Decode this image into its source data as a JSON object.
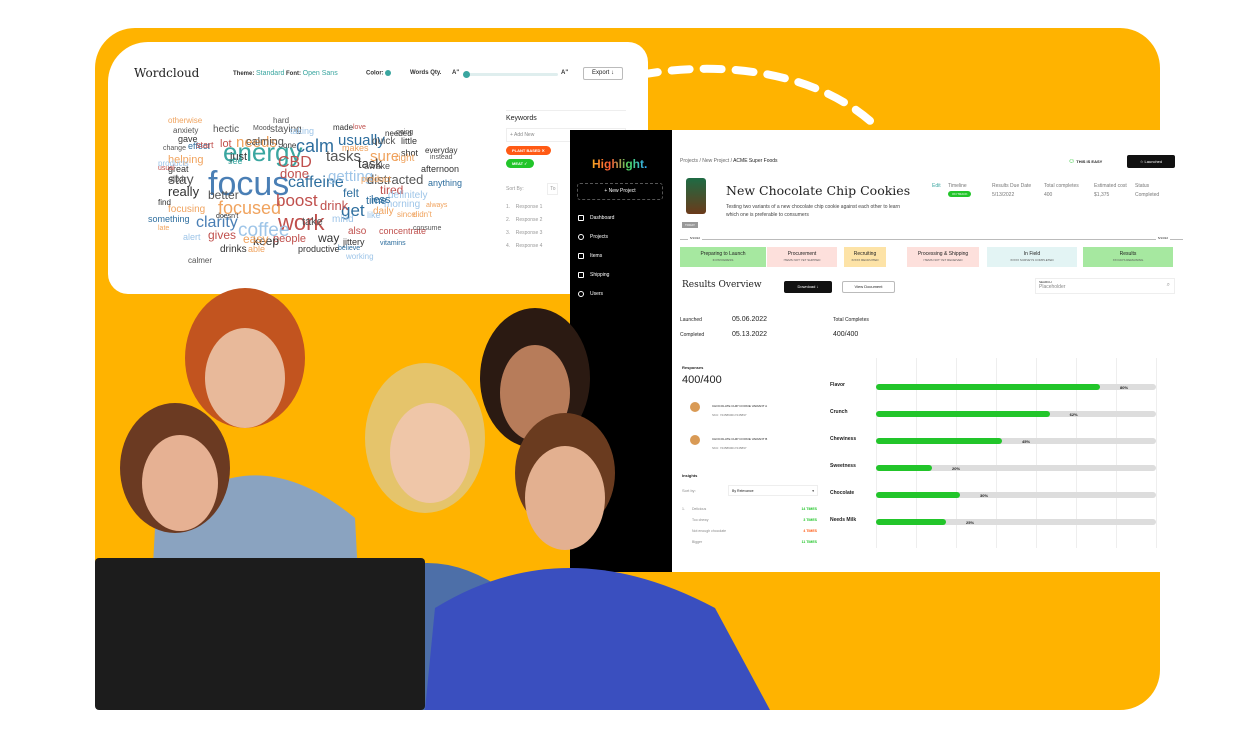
{
  "wordcloud": {
    "title": "Wordcloud",
    "theme_label": "Theme:",
    "theme": "Standard",
    "font_label": "Font:",
    "font": "Open Sans",
    "color_label": "Color:",
    "words_label": "Words Qty.",
    "a_small": "A\"",
    "a_large": "A\"",
    "export": "Export ↓",
    "words": [
      {
        "t": "focus",
        "c": "#4a7fb5"
      },
      {
        "t": "energy",
        "c": "#3aa6a0"
      },
      {
        "t": "work",
        "c": "#c0504d"
      },
      {
        "t": "calm",
        "c": "#2e6e9e"
      },
      {
        "t": "CBD",
        "c": "#c0504d"
      },
      {
        "t": "focused",
        "c": "#f0a35e"
      },
      {
        "t": "clarity",
        "c": "#4a7fb5"
      },
      {
        "t": "coffee",
        "c": "#9ec5e8"
      },
      {
        "t": "caffeine",
        "c": "#2e6e9e"
      },
      {
        "t": "tasks",
        "c": "#555"
      },
      {
        "t": "boost",
        "c": "#c0504d"
      },
      {
        "t": "get",
        "c": "#2e6e9e"
      },
      {
        "t": "drink",
        "c": "#c0504d"
      },
      {
        "t": "getting",
        "c": "#9ec5e8"
      },
      {
        "t": "usually",
        "c": "#2e6e9e"
      },
      {
        "t": "needs",
        "c": "#f0a35e"
      },
      {
        "t": "sure",
        "c": "#f0a35e"
      },
      {
        "t": "task",
        "c": "#333"
      },
      {
        "t": "distracted",
        "c": "#555"
      },
      {
        "t": "stay",
        "c": "#555"
      },
      {
        "t": "really",
        "c": "#333"
      },
      {
        "t": "better",
        "c": "#555"
      },
      {
        "t": "done",
        "c": "#c0504d"
      },
      {
        "t": "felt",
        "c": "#2e6e9e"
      },
      {
        "t": "tired",
        "c": "#c0504d"
      },
      {
        "t": "time",
        "c": "#2e6e9e"
      },
      {
        "t": "people",
        "c": "#c0504d"
      },
      {
        "t": "way",
        "c": "#333"
      },
      {
        "t": "take",
        "c": "#555"
      },
      {
        "t": "keep",
        "c": "#333"
      },
      {
        "t": "gives",
        "c": "#c0504d"
      },
      {
        "t": "easy",
        "c": "#f0a35e"
      },
      {
        "t": "just",
        "c": "#333"
      },
      {
        "t": "calming",
        "c": "#555"
      },
      {
        "t": "staying",
        "c": "#555"
      },
      {
        "t": "taking",
        "c": "#9ec5e8"
      },
      {
        "t": "hectic",
        "c": "#555"
      },
      {
        "t": "anxiety",
        "c": "#555"
      },
      {
        "t": "effect",
        "c": "#2e6e9e"
      },
      {
        "t": "lot",
        "c": "#c0504d"
      },
      {
        "t": "helping",
        "c": "#f0a35e"
      },
      {
        "t": "great",
        "c": "#333"
      },
      {
        "t": "elixir",
        "c": "#555"
      },
      {
        "t": "focusing",
        "c": "#f0a35e"
      },
      {
        "t": "something",
        "c": "#2e6e9e"
      },
      {
        "t": "alert",
        "c": "#9ec5e8"
      },
      {
        "t": "drinks",
        "c": "#333"
      },
      {
        "t": "daily",
        "c": "#f0a35e"
      },
      {
        "t": "like",
        "c": "#9ec5e8"
      },
      {
        "t": "also",
        "c": "#c0504d"
      },
      {
        "t": "concentrate",
        "c": "#c0504d"
      },
      {
        "t": "morning",
        "c": "#9ec5e8"
      },
      {
        "t": "definitely",
        "c": "#9ec5e8"
      },
      {
        "t": "anything",
        "c": "#2e6e9e"
      },
      {
        "t": "afternoon",
        "c": "#333"
      },
      {
        "t": "awake",
        "c": "#555"
      },
      {
        "t": "quick",
        "c": "#555"
      },
      {
        "t": "shot",
        "c": "#333"
      },
      {
        "t": "productive",
        "c": "#333"
      },
      {
        "t": "jittery",
        "c": "#333"
      },
      {
        "t": "vitamins",
        "c": "#2e6e9e"
      },
      {
        "t": "working",
        "c": "#9ec5e8"
      },
      {
        "t": "believe",
        "c": "#2e6e9e"
      },
      {
        "t": "makes",
        "c": "#f0a35e"
      },
      {
        "t": "mind",
        "c": "#9ec5e8"
      },
      {
        "t": "less",
        "c": "#2e6e9e"
      },
      {
        "t": "see",
        "c": "#3aa6a0"
      },
      {
        "t": "one",
        "c": "#333"
      },
      {
        "t": "made",
        "c": "#333"
      },
      {
        "t": "love",
        "c": "#c0504d"
      },
      {
        "t": "needed",
        "c": "#333"
      },
      {
        "t": "right",
        "c": "#f0a35e"
      },
      {
        "t": "little",
        "c": "#333"
      },
      {
        "t": "product",
        "c": "#f0a35e"
      },
      {
        "t": "since",
        "c": "#f0a35e"
      },
      {
        "t": "didn't",
        "c": "#f0a35e"
      },
      {
        "t": "always",
        "c": "#f0a35e"
      },
      {
        "t": "everyday",
        "c": "#333"
      },
      {
        "t": "instead",
        "c": "#555"
      },
      {
        "t": "going",
        "c": "#555"
      },
      {
        "t": "change",
        "c": "#555"
      },
      {
        "t": "products",
        "c": "#9ec5e8"
      },
      {
        "t": "usual",
        "c": "#c0504d"
      },
      {
        "t": "find",
        "c": "#333"
      },
      {
        "t": "late",
        "c": "#f0a35e"
      },
      {
        "t": "calmer",
        "c": "#555"
      },
      {
        "t": "doesn't",
        "c": "#333"
      },
      {
        "t": "Mood",
        "c": "#555"
      },
      {
        "t": "hard",
        "c": "#555"
      },
      {
        "t": "gave",
        "c": "#333"
      },
      {
        "t": "start",
        "c": "#c0504d"
      },
      {
        "t": "able",
        "c": "#f0a35e"
      },
      {
        "t": "consume",
        "c": "#555"
      },
      {
        "t": "otherwise",
        "c": "#f0a35e"
      }
    ],
    "keywords": {
      "title": "Keywords",
      "add": "+ Add New",
      "tags": [
        {
          "label": "PLANT BASED ✕",
          "color": "#ff5a14"
        },
        {
          "label": "MEAT ✓",
          "color": "#22c52a"
        }
      ],
      "sort_label": "Sort By:",
      "sort_value": "To",
      "responses": [
        "Response 1",
        "Response 2",
        "Response 3",
        "Response 4"
      ]
    }
  },
  "app": {
    "logo": "Highlight.",
    "new_project": "+ New Project",
    "nav": [
      "Dashboard",
      "Projects",
      "Items",
      "Shipping",
      "Users"
    ],
    "breadcrumb": [
      "Projects",
      "New Project",
      "ACME Super Foods"
    ],
    "easy": "THIS IS EASY",
    "launched": "☆ Launched",
    "title": "New Chocolate Chip Cookies",
    "description": "Testing two variants of a new chocolate chip cookie against each other to learn which one is preferable to consumers",
    "edit": "Edit",
    "meta": [
      {
        "label": "Timeline",
        "value": "ON TRACK"
      },
      {
        "label": "Results Due Date",
        "value": "5/13/2022"
      },
      {
        "label": "Total completes",
        "value": "400"
      },
      {
        "label": "Estimated cost",
        "value": "$1,375"
      },
      {
        "label": "Status",
        "value": "Completed"
      }
    ],
    "today": "TODAY",
    "timeline_start": "5/13/22",
    "timeline_end": "5/13/22",
    "stages": [
      {
        "name": "Preparing to Launch",
        "sub": "IN PROGRESS",
        "bg": "#a6e8a0"
      },
      {
        "name": "Procurement",
        "sub": "ITEMS NOT YET SHIPPED",
        "bg": "#fde0dc"
      },
      {
        "name": "Recruiting",
        "sub": "X/XXX RECRUITED",
        "bg": "#fde3a7"
      },
      {
        "name": "Processing & Shipping",
        "sub": "ITEMS NOT YET RECEIVED",
        "bg": "#fde0dc"
      },
      {
        "name": "In Field",
        "sub": "X/XXX SURVEYS COMPLETED",
        "bg": "#e3f4f4"
      },
      {
        "name": "Results",
        "sub": "XX DAYS REMAINING",
        "bg": "#a6e8a0"
      }
    ],
    "results": {
      "title": "Results Overview",
      "download": "Download ↓",
      "view_doc": "View Document",
      "search_label": "SEARCH",
      "search_placeholder": "Placeholder",
      "launched_label": "Launched",
      "launched": "05.06.2022",
      "completed_label": "Completed",
      "completed": "05.13.2022",
      "total_label": "Total Completes",
      "total": "400/400",
      "responses_label": "Responses",
      "responses": "400/400",
      "variants": [
        {
          "name": "CHOCOLATE CHIP COOKIE VARIANT A",
          "sku": "SKU: 7245890017245897"
        },
        {
          "name": "CHOCOLATE CHIP COOKIE VARIANT B",
          "sku": "SKU: 7245890017245897"
        }
      ],
      "insights_label": "Insights",
      "sort_label": "Sort by:",
      "sort_value": "By Relevance",
      "insights": [
        {
          "n": "1.",
          "text": "Delicious",
          "count": "14 TIMES",
          "color": "#22c52a"
        },
        {
          "n": "",
          "text": "Too chewy",
          "count": "3 TIMES",
          "color": "#22c52a"
        },
        {
          "n": "",
          "text": "Not enough chocolate",
          "count": "4 TIMES",
          "color": "#ff5a14"
        },
        {
          "n": "",
          "text": "Bigger",
          "count": "11 TIMES",
          "color": "#22c52a"
        }
      ]
    }
  },
  "chart_data": {
    "type": "bar",
    "orientation": "horizontal",
    "categories": [
      "Flavor",
      "Crunch",
      "Chewiness",
      "Sweetness",
      "Chocolate",
      "Needs Milk"
    ],
    "values": [
      80,
      62,
      45,
      20,
      30,
      25
    ],
    "value_labels": [
      "80%",
      "62%",
      "45%",
      "20%",
      "30%",
      "25%"
    ],
    "xlim": [
      0,
      100
    ],
    "grid": true,
    "color": "#22c52a"
  },
  "colors": {
    "orange": "#FFB300",
    "accent": "#22c52a"
  }
}
